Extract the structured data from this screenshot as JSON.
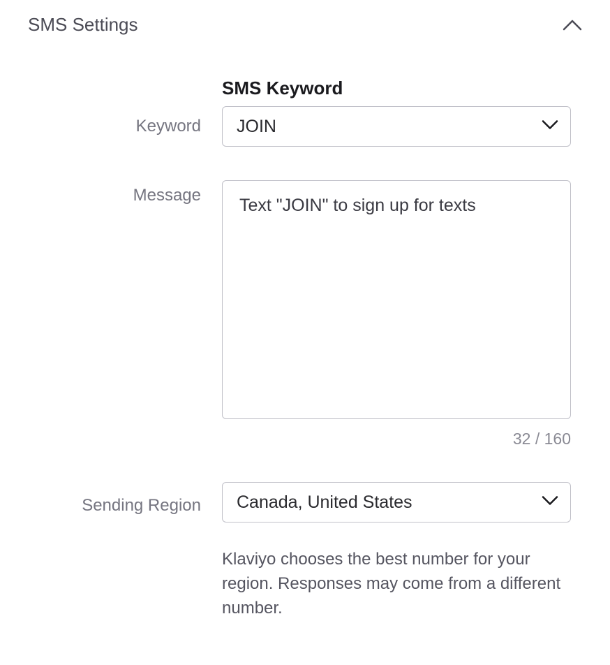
{
  "section": {
    "title": "SMS Settings"
  },
  "keyword": {
    "label": "Keyword",
    "field_label": "SMS Keyword",
    "value": "JOIN"
  },
  "message": {
    "label": "Message",
    "value": "Text \"JOIN\" to sign up for texts",
    "char_count": "32 / 160"
  },
  "region": {
    "label": "Sending Region",
    "value": "Canada, United States",
    "help_text": "Klaviyo chooses the best number for your region. Responses may come from a different number."
  }
}
